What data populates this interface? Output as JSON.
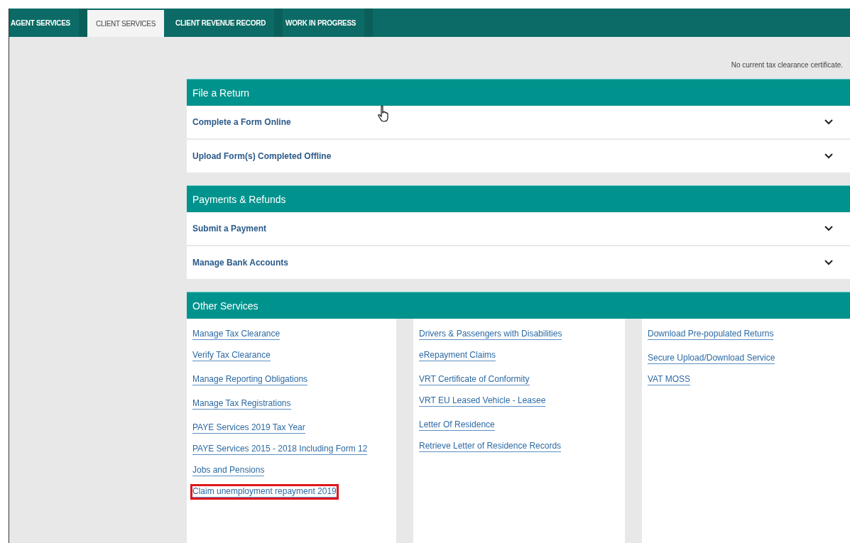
{
  "tabs": [
    {
      "label": "AGENT SERVICES",
      "selected": false
    },
    {
      "label": "CLIENT SERVICES",
      "selected": true
    },
    {
      "label": "CLIENT REVENUE RECORD",
      "selected": false
    },
    {
      "label": "WORK IN PROGRESS",
      "selected": false
    }
  ],
  "notice": "No current tax clearance certificate.",
  "panels": [
    {
      "title": "File a Return",
      "kind": "accordion",
      "rows": [
        {
          "label": "Complete a Form Online",
          "expanded": false
        },
        {
          "label": "Upload Form(s) Completed Offline",
          "expanded": false
        }
      ]
    },
    {
      "title": "Payments & Refunds",
      "kind": "accordion",
      "rows": [
        {
          "label": "Submit a Payment",
          "expanded": false
        },
        {
          "label": "Manage Bank Accounts",
          "expanded": false
        }
      ]
    },
    {
      "title": "Other Services",
      "kind": "links",
      "columns": [
        [
          [
            {
              "label": "Manage Tax Clearance",
              "highlighted": false
            },
            {
              "label": "Verify Tax Clearance",
              "highlighted": false
            }
          ],
          [
            {
              "label": "Manage Reporting Obligations",
              "highlighted": false
            }
          ],
          [
            {
              "label": "Manage Tax Registrations",
              "highlighted": false
            }
          ],
          [
            {
              "label": "PAYE Services 2019 Tax Year",
              "highlighted": false
            },
            {
              "label": "PAYE Services 2015 - 2018 Including Form 12",
              "highlighted": false
            },
            {
              "label": "Jobs and Pensions",
              "highlighted": false
            },
            {
              "label": "Claim unemployment repayment 2019",
              "highlighted": true
            }
          ]
        ],
        [
          [
            {
              "label": "Drivers & Passengers with Disabilities",
              "highlighted": false
            },
            {
              "label": "eRepayment Claims",
              "highlighted": false
            }
          ],
          [
            {
              "label": "VRT Certificate of Conformity",
              "highlighted": false
            },
            {
              "label": "VRT EU Leased Vehicle - Leasee",
              "highlighted": false
            }
          ],
          [
            {
              "label": "Letter Of Residence",
              "highlighted": false
            },
            {
              "label": "Retrieve Letter of Residence Records",
              "highlighted": false
            }
          ]
        ],
        [
          [
            {
              "label": "Download Pre-populated Returns",
              "highlighted": false
            }
          ],
          [
            {
              "label": "Secure Upload/Download Service",
              "highlighted": false
            },
            {
              "label": "VAT MOSS",
              "highlighted": false
            }
          ]
        ]
      ]
    }
  ]
}
